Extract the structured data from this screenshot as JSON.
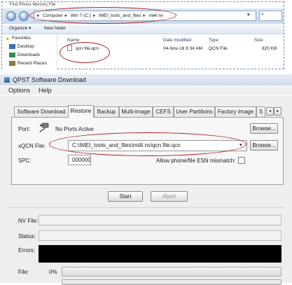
{
  "explorer": {
    "title": "Find Phone Memory File",
    "address": [
      "Computer",
      "Win 7 (C:)",
      "IMEI_tools_and_files",
      "mi4i nv"
    ],
    "organize_label": "Organize ▾",
    "new_folder_label": "New folder",
    "sidebar": [
      {
        "label": "Favorites",
        "icon": "star-icon",
        "color": "#e7b416"
      },
      {
        "label": "Desktop",
        "icon": "desktop-icon",
        "color": "#3b6fb6"
      },
      {
        "label": "Downloads",
        "icon": "downloads-icon",
        "color": "#3b6fb6"
      },
      {
        "label": "Recent Places",
        "icon": "recent-places-icon",
        "color": "#3b6fb6"
      }
    ],
    "columns": {
      "name": "Name",
      "modified": "Date modified",
      "type": "Type",
      "size": "Size"
    },
    "files": [
      {
        "name": "qcn file.qcn",
        "modified": "04-Nov-16 9:34 AM",
        "type": "QCN File",
        "size": "820 KB"
      }
    ]
  },
  "qpst": {
    "title": "QPST Software Download",
    "menu": [
      "Options",
      "Help"
    ],
    "tabs": [
      "Software Download",
      "Restore",
      "Backup",
      "Multi-image",
      "CEFS",
      "User Partitions",
      "Factory Image",
      "S"
    ],
    "active_tab": "Restore",
    "port_label": "Port:",
    "port_value": "No Ports Active",
    "browse_label": "Browse...",
    "xqcn_label": "xQCN File:",
    "xqcn_value": "C:\\IMEI_tools_and_files\\mi4i nv\\qcn file.qcn",
    "spc_label": "SPC:",
    "spc_value": "000000",
    "allow_label": "Allow phone/file ESN mismatch:",
    "start_label": "Start",
    "abort_label": "Abort",
    "nv_file_label": "NV File:",
    "status_label": "Status:",
    "errors_label": "Errors:",
    "file_label": "File:",
    "file_percent": "0%",
    "file_progress": 0
  },
  "colors": {
    "annotation": "#b41e1e",
    "explorer_accent": "#c9dbee"
  }
}
